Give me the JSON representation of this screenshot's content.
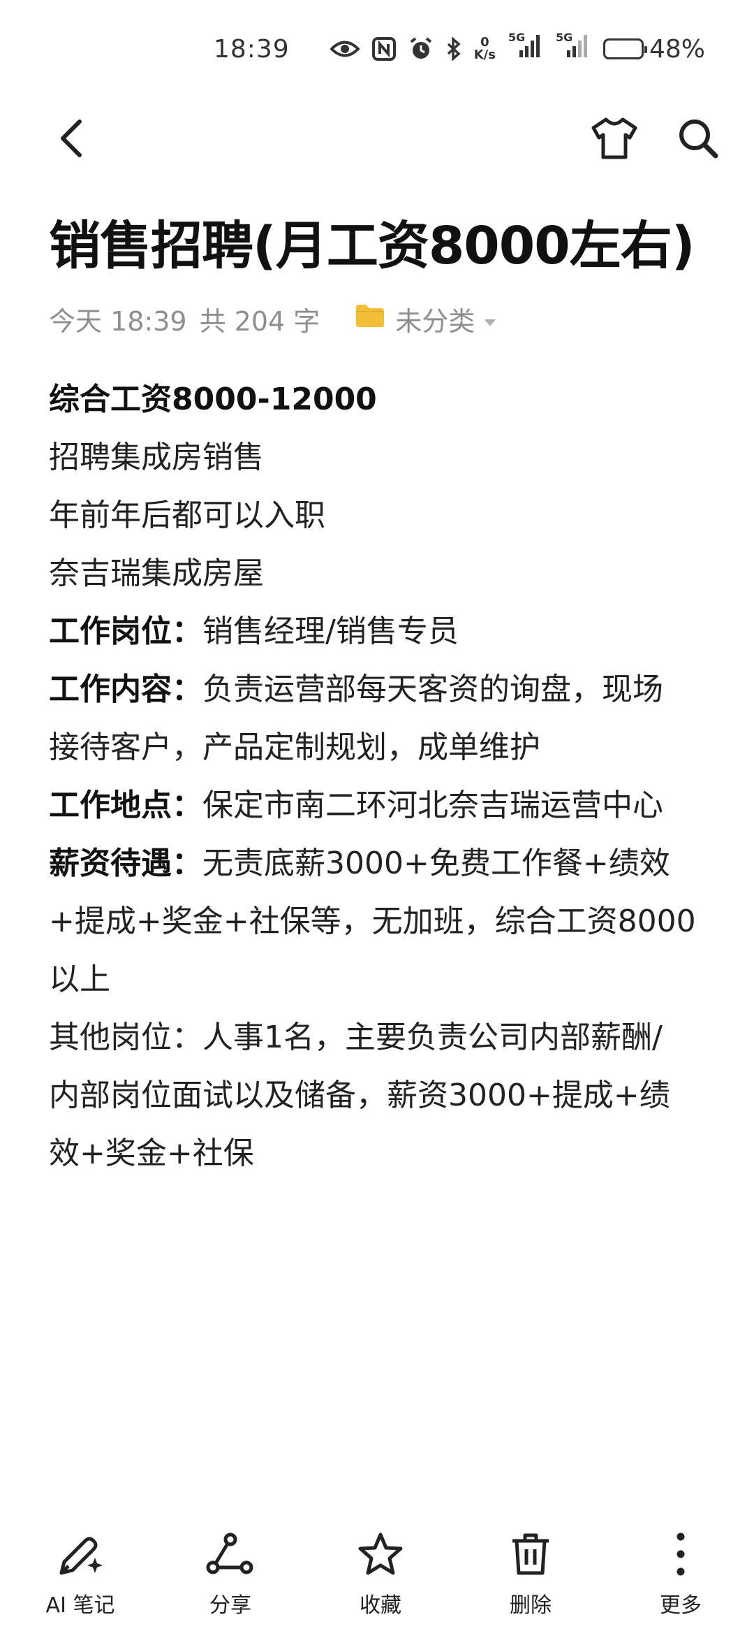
{
  "status_bar": {
    "time": "18:39",
    "net_speed_value": "0",
    "net_speed_unit": "K/s",
    "signal1_tag": "5G",
    "signal2_tag": "5G",
    "battery_percent_text": "48%",
    "battery_level": 0.48,
    "icons": [
      "eye-icon",
      "nfc-icon",
      "alarm-icon",
      "bluetooth-icon",
      "signal-icon",
      "battery-icon"
    ]
  },
  "nav": {
    "icons": [
      "back-arrow-icon",
      "tshirt-icon",
      "search-icon"
    ]
  },
  "note": {
    "title": "销售招聘(月工资8000左右)",
    "meta": {
      "date": "今天 18:39",
      "word_count": "共 204 字",
      "category": "未分类"
    },
    "body": {
      "line1": "综合工资8000-12000",
      "line2": "招聘集成房销售",
      "line3": "年前年后都可以入职",
      "line4": "奈吉瑞集成房屋",
      "line5_label": "工作岗位：",
      "line5_text": "销售经理/销售专员",
      "line6_label": "工作内容：",
      "line6_text": "负责运营部每天客资的询盘，现场",
      "line7": "接待客户，产品定制规划，成单维护",
      "line8_label": "工作地点：",
      "line8_text": "保定市南二环河北奈吉瑞运营中心",
      "line9_label": "薪资待遇：",
      "line9_text": "无责底薪3000+免费工作餐+绩效",
      "line10": "+提成+奖金+社保等，无加班，综合工资8000",
      "line11": "以上",
      "line12": "其他岗位：人事1名，主要负责公司内部薪酬/",
      "line13": "内部岗位面试以及储备，薪资3000+提成+绩",
      "line14": "效+奖金+社保"
    }
  },
  "toolbar": {
    "ai_notes": "AI 笔记",
    "share": "分享",
    "favorite": "收藏",
    "delete": "删除",
    "more": "更多"
  },
  "colors": {
    "folder": "#F2BE3A",
    "meta_text": "#8E8E8E",
    "body_text": "#222222"
  }
}
